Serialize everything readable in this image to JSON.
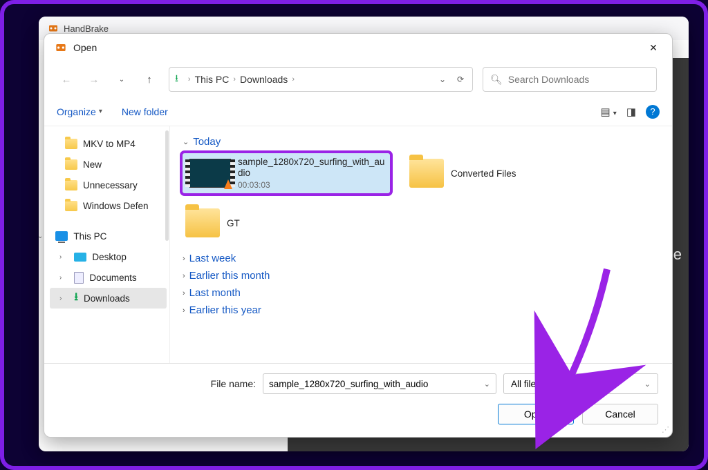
{
  "app": {
    "title": "HandBrake"
  },
  "dialog": {
    "title": "Open",
    "breadcrumb": {
      "root": "This PC",
      "folder": "Downloads"
    },
    "search": {
      "placeholder": "Search Downloads"
    },
    "toolbar": {
      "organize": "Organize",
      "new_folder": "New folder"
    },
    "tree": {
      "quick": [
        {
          "label": "MKV to MP4"
        },
        {
          "label": "New"
        },
        {
          "label": "Unnecessary"
        },
        {
          "label": "Windows Defen"
        }
      ],
      "this_pc": "This PC",
      "children": [
        {
          "label": "Desktop"
        },
        {
          "label": "Documents"
        },
        {
          "label": "Downloads"
        }
      ]
    },
    "groups": {
      "today": "Today",
      "last_week": "Last week",
      "earlier_month": "Earlier this month",
      "last_month": "Last month",
      "earlier_year": "Earlier this year"
    },
    "files": {
      "video": {
        "name": "sample_1280x720_surfing_with_audio",
        "duration": "00:03:03"
      },
      "folder1": {
        "name": "Converted Files"
      },
      "folder2": {
        "name": "GT"
      }
    },
    "footer": {
      "filename_label": "File name:",
      "filename_value": "sample_1280x720_surfing_with_audio",
      "filter": "All files",
      "open": "Open",
      "cancel": "Cancel"
    }
  }
}
